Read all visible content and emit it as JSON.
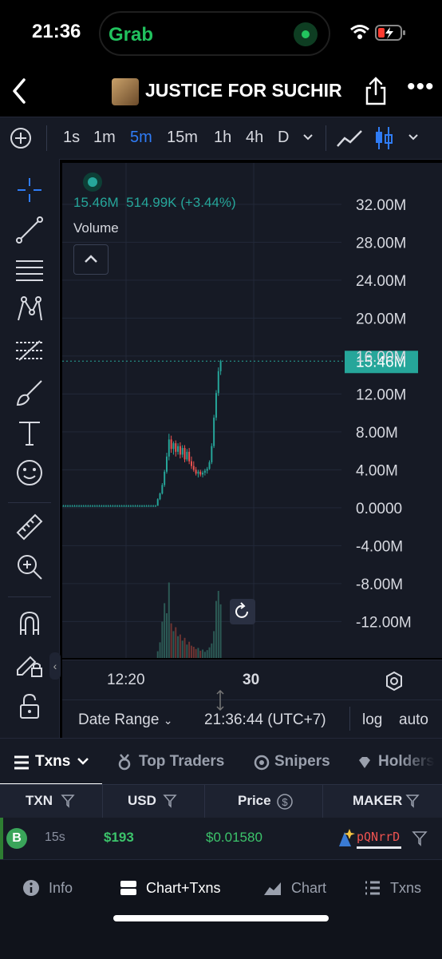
{
  "status": {
    "time": "21:36",
    "live_activity": "Grab"
  },
  "header": {
    "title": "JUSTICE FOR SUCHIR"
  },
  "timeframes": [
    "1s",
    "1m",
    "5m",
    "15m",
    "1h",
    "4h",
    "D"
  ],
  "active_timeframe": "5m",
  "legend": {
    "ohlc": "15.46M",
    "change": "514.99K (+3.44%)",
    "volume_label": "Volume"
  },
  "chart_data": {
    "type": "candlestick",
    "y_ticks": [
      "32.00M",
      "28.00M",
      "24.00M",
      "20.00M",
      "16.00M",
      "12.00M",
      "8.00M",
      "4.00M",
      "0.0000",
      "-4.00M",
      "-8.00M",
      "-12.00M"
    ],
    "x_ticks": [
      "12:20",
      "30"
    ],
    "last_price_label": "15.46M",
    "last_price": 15.46,
    "ylim": [
      -15.0,
      33.0
    ],
    "up_color": "#26a69a",
    "down_color": "#ef5350",
    "candles": [
      {
        "o": 0.2,
        "h": 0.3,
        "l": 0.1,
        "c": 0.2
      },
      {
        "o": 0.2,
        "h": 0.3,
        "l": 0.1,
        "c": 0.2
      },
      {
        "o": 0.2,
        "h": 0.3,
        "l": 0.1,
        "c": 0.2
      },
      {
        "o": 0.2,
        "h": 0.3,
        "l": 0.1,
        "c": 0.2
      },
      {
        "o": 0.2,
        "h": 0.3,
        "l": 0.1,
        "c": 0.2
      },
      {
        "o": 0.2,
        "h": 0.3,
        "l": 0.1,
        "c": 0.2
      },
      {
        "o": 0.2,
        "h": 0.3,
        "l": 0.1,
        "c": 0.2
      },
      {
        "o": 0.2,
        "h": 0.3,
        "l": 0.1,
        "c": 0.2
      },
      {
        "o": 0.2,
        "h": 0.3,
        "l": 0.1,
        "c": 0.2
      },
      {
        "o": 0.2,
        "h": 0.3,
        "l": 0.1,
        "c": 0.2
      },
      {
        "o": 0.2,
        "h": 0.3,
        "l": 0.1,
        "c": 0.2
      },
      {
        "o": 0.2,
        "h": 0.3,
        "l": 0.1,
        "c": 0.2
      },
      {
        "o": 0.2,
        "h": 0.3,
        "l": 0.1,
        "c": 0.2
      },
      {
        "o": 0.2,
        "h": 0.3,
        "l": 0.1,
        "c": 0.2
      },
      {
        "o": 0.2,
        "h": 0.3,
        "l": 0.1,
        "c": 0.2
      },
      {
        "o": 0.2,
        "h": 0.3,
        "l": 0.1,
        "c": 0.2
      },
      {
        "o": 0.2,
        "h": 0.3,
        "l": 0.1,
        "c": 0.2
      },
      {
        "o": 0.2,
        "h": 0.3,
        "l": 0.1,
        "c": 0.2
      },
      {
        "o": 0.2,
        "h": 0.3,
        "l": 0.1,
        "c": 0.2
      },
      {
        "o": 0.2,
        "h": 0.3,
        "l": 0.1,
        "c": 0.2
      },
      {
        "o": 0.2,
        "h": 0.3,
        "l": 0.1,
        "c": 0.2
      },
      {
        "o": 0.2,
        "h": 0.3,
        "l": 0.1,
        "c": 0.2
      },
      {
        "o": 0.2,
        "h": 0.3,
        "l": 0.1,
        "c": 0.2
      },
      {
        "o": 0.2,
        "h": 0.3,
        "l": 0.1,
        "c": 0.2
      },
      {
        "o": 0.2,
        "h": 0.3,
        "l": 0.1,
        "c": 0.2
      },
      {
        "o": 0.2,
        "h": 0.3,
        "l": 0.1,
        "c": 0.2
      },
      {
        "o": 0.2,
        "h": 0.3,
        "l": 0.1,
        "c": 0.2
      },
      {
        "o": 0.2,
        "h": 0.3,
        "l": 0.1,
        "c": 0.2
      },
      {
        "o": 0.2,
        "h": 0.3,
        "l": 0.1,
        "c": 0.2
      },
      {
        "o": 0.2,
        "h": 0.3,
        "l": 0.1,
        "c": 0.2
      },
      {
        "o": 0.2,
        "h": 0.3,
        "l": 0.1,
        "c": 0.2
      },
      {
        "o": 0.2,
        "h": 0.3,
        "l": 0.1,
        "c": 0.2
      },
      {
        "o": 0.2,
        "h": 0.3,
        "l": 0.1,
        "c": 0.2
      },
      {
        "o": 0.2,
        "h": 0.3,
        "l": 0.1,
        "c": 0.2
      },
      {
        "o": 0.2,
        "h": 0.3,
        "l": 0.1,
        "c": 0.2
      },
      {
        "o": 0.2,
        "h": 0.3,
        "l": 0.1,
        "c": 0.2
      },
      {
        "o": 0.2,
        "h": 0.3,
        "l": 0.1,
        "c": 0.2
      },
      {
        "o": 0.2,
        "h": 0.3,
        "l": 0.1,
        "c": 0.2
      },
      {
        "o": 0.2,
        "h": 0.3,
        "l": 0.1,
        "c": 0.2
      },
      {
        "o": 0.2,
        "h": 0.3,
        "l": 0.1,
        "c": 0.2
      },
      {
        "o": 0.2,
        "h": 0.3,
        "l": 0.1,
        "c": 0.2
      },
      {
        "o": 0.2,
        "h": 0.3,
        "l": 0.1,
        "c": 0.2
      },
      {
        "o": 0.2,
        "h": 1.0,
        "l": 0.2,
        "c": 0.9
      },
      {
        "o": 0.9,
        "h": 1.6,
        "l": 0.8,
        "c": 1.5
      },
      {
        "o": 1.5,
        "h": 2.6,
        "l": 1.4,
        "c": 2.4
      },
      {
        "o": 2.4,
        "h": 4.0,
        "l": 2.2,
        "c": 3.8
      },
      {
        "o": 3.8,
        "h": 5.8,
        "l": 3.6,
        "c": 5.4
      },
      {
        "o": 5.4,
        "h": 7.8,
        "l": 5.0,
        "c": 7.2
      },
      {
        "o": 7.2,
        "h": 7.6,
        "l": 5.8,
        "c": 6.2
      },
      {
        "o": 6.2,
        "h": 7.0,
        "l": 5.6,
        "c": 6.8
      },
      {
        "o": 6.8,
        "h": 7.1,
        "l": 5.4,
        "c": 5.9
      },
      {
        "o": 5.9,
        "h": 6.8,
        "l": 5.6,
        "c": 6.5
      },
      {
        "o": 6.5,
        "h": 6.9,
        "l": 5.2,
        "c": 5.6
      },
      {
        "o": 5.6,
        "h": 6.6,
        "l": 5.3,
        "c": 6.3
      },
      {
        "o": 6.3,
        "h": 6.6,
        "l": 4.8,
        "c": 5.1
      },
      {
        "o": 5.1,
        "h": 6.2,
        "l": 4.9,
        "c": 5.9
      },
      {
        "o": 5.9,
        "h": 6.3,
        "l": 4.6,
        "c": 4.9
      },
      {
        "o": 4.9,
        "h": 5.4,
        "l": 4.1,
        "c": 4.4
      },
      {
        "o": 4.4,
        "h": 4.9,
        "l": 3.8,
        "c": 4.0
      },
      {
        "o": 4.0,
        "h": 4.3,
        "l": 3.4,
        "c": 3.6
      },
      {
        "o": 3.6,
        "h": 4.0,
        "l": 3.2,
        "c": 3.8
      },
      {
        "o": 3.8,
        "h": 4.0,
        "l": 3.3,
        "c": 3.5
      },
      {
        "o": 3.5,
        "h": 3.9,
        "l": 3.2,
        "c": 3.7
      },
      {
        "o": 3.7,
        "h": 4.1,
        "l": 3.4,
        "c": 3.9
      },
      {
        "o": 3.9,
        "h": 4.3,
        "l": 3.6,
        "c": 4.1
      },
      {
        "o": 4.1,
        "h": 5.0,
        "l": 4.0,
        "c": 4.8
      },
      {
        "o": 4.8,
        "h": 6.8,
        "l": 4.6,
        "c": 6.5
      },
      {
        "o": 6.5,
        "h": 9.8,
        "l": 6.3,
        "c": 9.5
      },
      {
        "o": 9.5,
        "h": 12.4,
        "l": 9.2,
        "c": 12.1
      },
      {
        "o": 12.1,
        "h": 14.8,
        "l": 11.8,
        "c": 14.4
      },
      {
        "o": 14.4,
        "h": 15.6,
        "l": 14.0,
        "c": 15.46
      }
    ],
    "volumes": [
      0,
      0,
      0,
      0,
      0,
      0,
      0,
      0,
      0,
      0,
      0,
      0,
      0,
      0,
      0,
      0,
      0,
      0,
      0,
      0,
      0,
      0,
      0,
      0,
      0,
      0,
      0,
      0,
      0,
      0,
      0,
      0,
      0,
      0,
      0,
      0,
      0,
      0,
      0,
      0,
      0,
      0,
      1.2,
      2.8,
      6.5,
      9.8,
      8.0,
      13.5,
      6.2,
      4.8,
      5.5,
      3.9,
      4.2,
      3.1,
      3.6,
      2.4,
      2.9,
      2.2,
      2.0,
      1.6,
      1.8,
      1.3,
      1.5,
      1.1,
      1.4,
      1.9,
      2.6,
      4.8,
      10.2,
      12.0,
      9.6,
      21.0
    ]
  },
  "bottom_bar": {
    "date_range": "Date Range",
    "clock": "21:36:44 (UTC+7)",
    "log": "log",
    "auto": "auto"
  },
  "txn_tabs": [
    "Txns",
    "Top Traders",
    "Snipers",
    "Holders"
  ],
  "table": {
    "headers": [
      "TXN",
      "USD",
      "Price",
      "MAKER"
    ],
    "row": {
      "type": "B",
      "age": "15s",
      "usd": "$193",
      "price": "$0.01580",
      "maker": "pQNrrD"
    }
  },
  "nav": [
    "Info",
    "Chart+Txns",
    "Chart",
    "Txns"
  ]
}
